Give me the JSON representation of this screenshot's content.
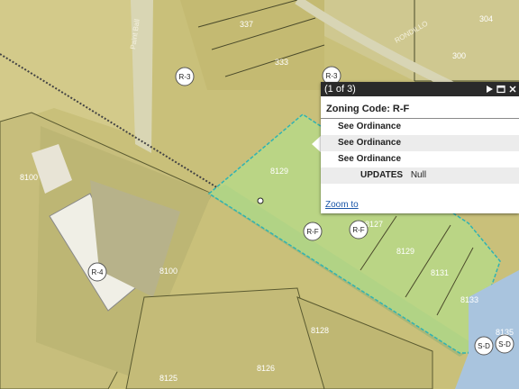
{
  "map": {
    "street_labels": {
      "north_street": "Paint Ball",
      "road_east": "RONDILLO"
    },
    "parcel_numbers": {
      "p337": "337",
      "p333": "333",
      "p304": "304",
      "p300": "300",
      "p8100_west": "8100",
      "p8100_center": "8100",
      "p8129": "8129",
      "p8127": "8127",
      "p8129b": "8129",
      "p8131": "8131",
      "p8133": "8133",
      "p8135": "8135",
      "p8128": "8128",
      "p8126": "8126",
      "p8125": "8125"
    },
    "zone_badges": {
      "r3_west": "R-3",
      "r3_north": "R-3",
      "r4": "R-4",
      "rf_left": "R-F",
      "rf_right": "R-F",
      "sd_left": "S-D",
      "sd_right": "S-D"
    },
    "colors": {
      "base": "#c9c07a",
      "highlight_fill": "#b4dc8a",
      "highlight_stroke": "#2fb3b3",
      "sd_zone": "#a9c4de"
    }
  },
  "popup": {
    "page_indicator": "(1 of 3)",
    "title": "Zoning Code: R-F",
    "rows": [
      {
        "label": "See Ordinance",
        "value": ""
      },
      {
        "label": "See Ordinance",
        "value": ""
      },
      {
        "label": "See Ordinance",
        "value": ""
      },
      {
        "label": "UPDATES",
        "value": "Null"
      }
    ],
    "zoom_link": "Zoom to",
    "icons": [
      "play-icon",
      "maximize-icon",
      "close-icon"
    ]
  }
}
